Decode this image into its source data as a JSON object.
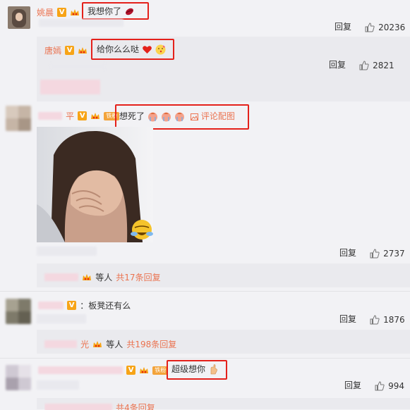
{
  "comments": [
    {
      "user": "姚晨",
      "text": "我想你了",
      "reply_label": "回复",
      "likes": "20236"
    },
    {
      "user": "唐嫣",
      "text": "给你么么哒",
      "reply_label": "回复",
      "likes": "2821"
    },
    {
      "user_suffix": "平",
      "fan_badge": "铁粉",
      "text": "想死了",
      "picture_link": "评论配图",
      "reply_label": "回复",
      "likes": "2737",
      "thread": {
        "others_label": "等人",
        "count_label": "共17条回复"
      }
    },
    {
      "text": "板凳还有么",
      "reply_label": "回复",
      "likes": "1876",
      "thread": {
        "user_suffix": "光",
        "others_label": "等人",
        "count_label": "共198条回复"
      }
    },
    {
      "fan_badge": "铁粉",
      "text": "超级想你",
      "reply_label": "回复",
      "likes": "994",
      "thread": {
        "count_label": "共4条回复"
      }
    }
  ],
  "colors": {
    "highlight_box": "#e4211b",
    "username": "#eb7350",
    "background": "#f2f2f5",
    "verified_badge": "#f7a417"
  }
}
